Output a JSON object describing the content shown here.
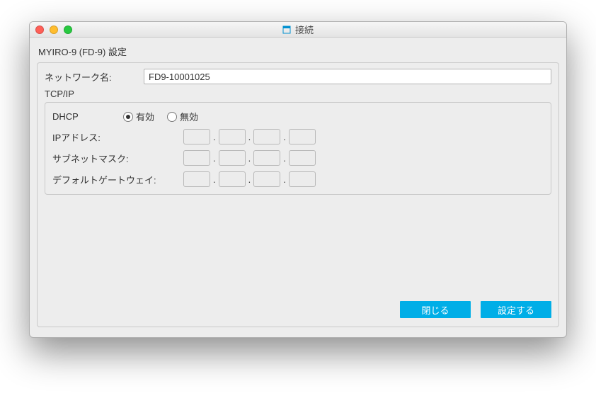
{
  "window": {
    "title": "接続"
  },
  "header": {
    "title": "MYIRO-9 (FD-9) 設定"
  },
  "network": {
    "name_label": "ネットワーク名:",
    "name_value": "FD9-10001025"
  },
  "tcpip": {
    "section_title": "TCP/IP",
    "dhcp_label": "DHCP",
    "dhcp_enabled_label": "有効",
    "dhcp_disabled_label": "無効",
    "dhcp_selected": "enabled",
    "ip_label": "IPアドレス:",
    "ip": [
      "",
      "",
      "",
      ""
    ],
    "subnet_label": "サブネットマスク:",
    "subnet": [
      "",
      "",
      "",
      ""
    ],
    "gateway_label": "デフォルトゲートウェイ:",
    "gateway": [
      "",
      "",
      "",
      ""
    ]
  },
  "buttons": {
    "close": "閉じる",
    "apply": "設定する"
  },
  "colors": {
    "accent": "#00aee7"
  }
}
